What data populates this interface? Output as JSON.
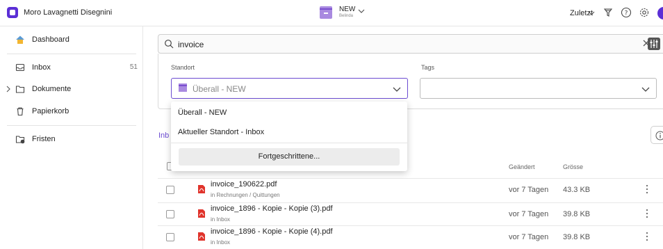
{
  "topbar": {
    "org_name": "Moro Lavagnetti Disegnini",
    "workspace_name": "NEW",
    "workspace_user": "Belinda",
    "sort_label": "Zuletzt",
    "icons": [
      "brand-logo",
      "archive-box-icon",
      "chevron-down-icon",
      "funnel-icon",
      "help-icon",
      "settings-gear-icon",
      "user-avatar"
    ]
  },
  "sidebar": {
    "items": [
      {
        "label": "Dashboard",
        "icon": "home-icon"
      },
      {
        "label": "Inbox",
        "count": "51",
        "icon": "inbox-icon"
      },
      {
        "label": "Dokumente",
        "icon": "folder-icon"
      },
      {
        "label": "Papierkorb",
        "icon": "trash-icon"
      },
      {
        "label": "Fristen",
        "icon": "calendar-clock-icon"
      }
    ]
  },
  "search": {
    "value": "invoice"
  },
  "filters": {
    "standort_label": "Standort",
    "standort_value": "Überall - NEW",
    "tags_label": "Tags",
    "tags_value": ""
  },
  "dropdown": {
    "options": [
      "Überall - NEW",
      "Aktueller Standort - Inbox"
    ],
    "advanced_label": "Fortgeschrittene..."
  },
  "results": {
    "crumb": "Inb",
    "columns": {
      "changed": "Geändert",
      "size": "Grösse"
    },
    "rows": [
      {
        "name": "invoice_190622.pdf",
        "location": "in Rechnungen / Quittungen",
        "changed": "vor 7 Tagen",
        "size": "43.3 KB"
      },
      {
        "name": "invoice_1896 - Kopie - Kopie (3).pdf",
        "location": "in Inbox",
        "changed": "vor 7 Tagen",
        "size": "39.8 KB"
      },
      {
        "name": "invoice_1896 - Kopie - Kopie (4).pdf",
        "location": "in Inbox",
        "changed": "vor 7 Tagen",
        "size": "39.8 KB"
      }
    ]
  },
  "colors": {
    "accent": "#5b2fd6",
    "workspace_box": "#a98ae0",
    "pdf_red": "#e0342c"
  }
}
